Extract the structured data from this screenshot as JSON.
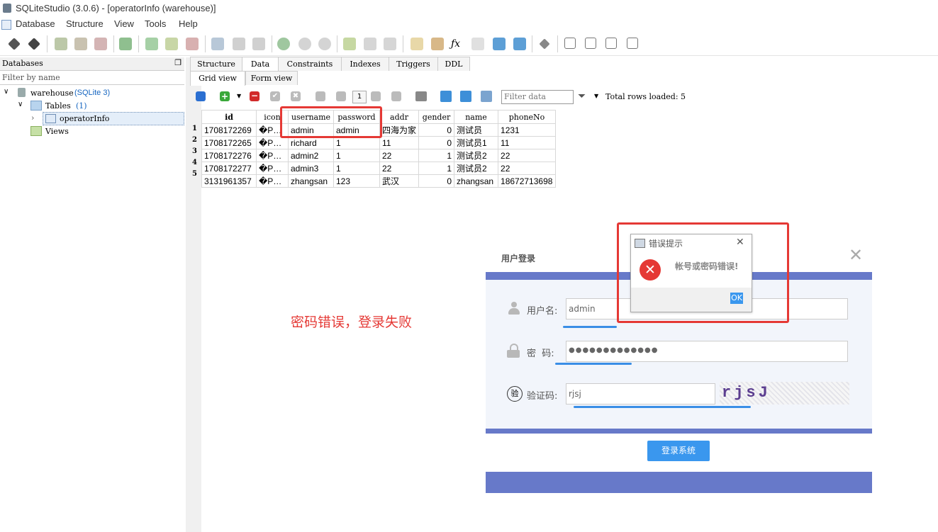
{
  "app": {
    "title": "SQLiteStudio (3.0.6) - [operatorInfo (warehouse)]",
    "menu": [
      "Database",
      "Structure",
      "View",
      "Tools",
      "Help"
    ]
  },
  "left_panel": {
    "header": "Databases",
    "filter_placeholder": "Filter by name",
    "db_name": "warehouse",
    "db_type": "(SQLite 3)",
    "tables_label": "Tables",
    "tables_count": "(1)",
    "table_item": "operatorInfo",
    "views_label": "Views"
  },
  "tabs": [
    "Structure",
    "Data",
    "Constraints",
    "Indexes",
    "Triggers",
    "DDL"
  ],
  "subtabs": [
    "Grid view",
    "Form view"
  ],
  "data_toolbar": {
    "page_number": "1",
    "filter_placeholder": "Filter data",
    "total_rows": "Total rows loaded: 5"
  },
  "grid": {
    "columns": [
      "id",
      "icon",
      "username",
      "password",
      "addr",
      "gender",
      "name",
      "phoneNo"
    ],
    "rows": [
      [
        "1708172269",
        "�P…",
        "admin",
        "admin",
        "四海为家",
        "0",
        "测试员",
        "1231"
      ],
      [
        "1708172265",
        "�P…",
        "richard",
        "1",
        "11",
        "0",
        "测试员1",
        "11"
      ],
      [
        "1708172276",
        "�P…",
        "admin2",
        "1",
        "22",
        "1",
        "测试员2",
        "22"
      ],
      [
        "1708172277",
        "�P…",
        "admin3",
        "1",
        "22",
        "1",
        "测试员2",
        "22"
      ],
      [
        "3131961357",
        "�P…",
        "zhangsan",
        "123",
        "武汉",
        "0",
        "zhangsan",
        "18672713698"
      ]
    ],
    "row_numbers": [
      "1",
      "2",
      "3",
      "4",
      "5"
    ]
  },
  "annotation": "密码错误，登录失败",
  "login": {
    "title": "用户登录",
    "username_label": "用户名:",
    "username_value": "admin",
    "password_label": "密  码:",
    "password_value": "●●●●●●●●●●●●●",
    "captcha_label": "验证码:",
    "captcha_value": "rjsj",
    "captcha_image_text": "rjsJ",
    "login_button": "登录系统",
    "accent": "#6779c9"
  },
  "error_dialog": {
    "title": "错误提示",
    "message": "帐号或密码错误!",
    "ok_button": "OK"
  },
  "colors": {
    "highlight_red": "#e53935",
    "annotation_red": "#e53935",
    "link_blue": "#1565c0"
  }
}
